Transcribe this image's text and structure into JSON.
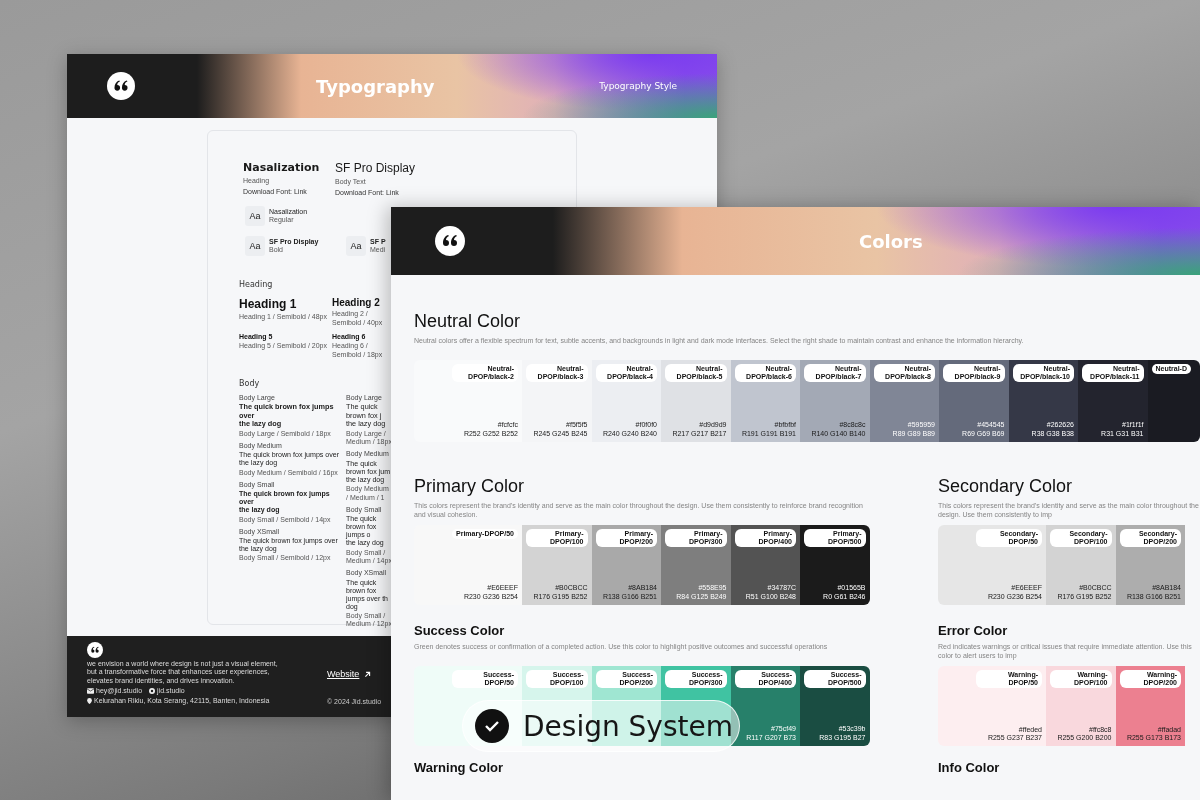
{
  "typography_page": {
    "header": {
      "title": "Typography",
      "subtitle": "Typography Style"
    },
    "fonts": [
      {
        "name": "Nasalization",
        "role": "Heading",
        "download": "Download Font: Link"
      },
      {
        "name": "SF Pro Display",
        "role": "Body Text",
        "download": "Download Font: Link"
      }
    ],
    "samples": [
      [
        {
          "glyph": "Aa",
          "name": "Nasalization",
          "weight": "Regular"
        }
      ],
      [
        {
          "glyph": "Aa",
          "name": "SF Pro Display",
          "weight": "Bold"
        },
        {
          "glyph": "Aa",
          "name": "SF P",
          "weight": "Medi"
        }
      ]
    ],
    "heading_section": {
      "title": "Heading",
      "items": [
        {
          "kind": "h1",
          "label": "Heading 1",
          "spec": "Heading 1 / Semibold / 48px"
        },
        {
          "kind": "h2",
          "label": "Heading 2",
          "spec": "Heading 2 / Semibold / 40px"
        },
        {
          "kind": "h5",
          "label": "Heading 5",
          "spec": "Heading 5 / Semibold / 20px"
        },
        {
          "kind": "h6",
          "label": "Heading 6",
          "spec": "Heading 6 / Semibold / 18px"
        }
      ]
    },
    "body_section": {
      "title": "Body",
      "columns": [
        [
          {
            "kind": "large",
            "label": "Body Large",
            "semibold": true,
            "lines": [
              "The quick brown fox jumps over",
              "the lazy dog"
            ],
            "spec": "Body Large / Semibold / 18px"
          },
          {
            "kind": "medium",
            "label": "Body Medium",
            "semibold": false,
            "lines": [
              "The quick brown fox jumps over",
              "the lazy dog"
            ],
            "spec": "Body Medium / Semibold / 16px"
          },
          {
            "kind": "small",
            "label": "Body Small",
            "semibold": true,
            "lines": [
              "The quick brown fox jumps over",
              "the lazy dog"
            ],
            "spec": "Body Small / Semibold / 14px"
          },
          {
            "kind": "xsmall",
            "label": "Body XSmall",
            "semibold": false,
            "lines": [
              "The quick brown fox jumps over",
              "the lazy dog"
            ],
            "spec": "Body Small / Semibold / 12px"
          }
        ],
        [
          {
            "kind": "large",
            "label": "Body Large",
            "semibold": false,
            "lines": [
              "The quick brown fox j",
              "the lazy dog"
            ],
            "spec": "Body Large / Medium / 18px"
          },
          {
            "kind": "medium",
            "label": "Body Medium",
            "semibold": false,
            "lines": [
              "The quick brown fox jum",
              "the lazy dog"
            ],
            "spec": "Body Medium / Medium / 1"
          },
          {
            "kind": "small",
            "label": "Body Small",
            "semibold": false,
            "lines": [
              "The quick brown fox jumps o",
              "the lazy dog"
            ],
            "spec": "Body Small / Medium / 14px"
          },
          {
            "kind": "xsmall",
            "label": "Body XSmall",
            "semibold": false,
            "lines": [
              "The quick brown fox jumps over th",
              "dog"
            ],
            "spec": "Body Small / Medium / 12px"
          }
        ]
      ]
    },
    "footer": {
      "text": "we envision a world where design is not just a visual element, but a transformative force that enhances user experiences, elevates brand identities, and drives innovation.",
      "contacts": [
        {
          "kind": "mail",
          "text": "hey@jid.studio"
        },
        {
          "kind": "social",
          "text": "jid.studio"
        },
        {
          "kind": "location",
          "text": "Kelurahan Rikiu, Kota Serang, 42115, Banten, Indonesia"
        }
      ],
      "link": "Website",
      "copyright": "© 2024 Jid.studio"
    }
  },
  "colors_page": {
    "header": {
      "title": "Colors"
    },
    "rows": [
      [
        {
          "title": "Neutral Color",
          "description": "Neutral colors offer a flexible spectrum for text, subtle accents, and backgrounds in light and dark mode interfaces. Select the right shade to maintain contrast and enhance the information hierarchy.",
          "swatches": [
            {
              "label": "Neutral-DPOP/black-2",
              "hex": "#fcfcfc",
              "rgb": "R252 G252 B252",
              "color": "#f9fafb"
            },
            {
              "label": "Neutral-DPOP/black-3",
              "hex": "#f5f5f5",
              "rgb": "R245 G245 B245",
              "color": "#f4f5f7"
            },
            {
              "label": "Neutral-DPOP/black-4",
              "hex": "#f0f0f0",
              "rgb": "R240 G240 B240",
              "color": "#eceef2"
            },
            {
              "label": "Neutral-DPOP/black-5",
              "hex": "#d9d9d9",
              "rgb": "R217 G217 B217",
              "color": "#dfe1e5"
            },
            {
              "label": "Neutral-DPOP/black-6",
              "hex": "#bfbfbf",
              "rgb": "R191 G191 B191",
              "color": "#c0c5cf"
            },
            {
              "label": "Neutral-DPOP/black-7",
              "hex": "#8c8c8c",
              "rgb": "R140 G140 B140",
              "color": "#a3a9b5"
            },
            {
              "label": "Neutral-DPOP/black-8",
              "hex": "#595959",
              "rgb": "R89 G89 B89",
              "color": "#808696"
            },
            {
              "label": "Neutral-DPOP/black-9",
              "hex": "#454545",
              "rgb": "R69 G69 B69",
              "color": "#646a7b"
            },
            {
              "label": "Neutral-DPOP/black-10",
              "hex": "#262626",
              "rgb": "R38 G38 B38",
              "color": "#353847"
            },
            {
              "label": "Neutral-DPOP/black-11",
              "hex": "#1f1f1f",
              "rgb": "R31 G31 B31",
              "color": "#23242e"
            },
            {
              "label": "Neutral-D",
              "color": "#1a1b22"
            }
          ]
        }
      ],
      [
        {
          "title": "Primary Color",
          "description": "This colors represent the brand's identity and serve as the main color throughout the design. Use them consistently to reinforce brand recognition and visual cohesion.",
          "swatches": [
            {
              "label": "Primary-DPOP/50",
              "hex": "#E6EEEF",
              "rgb": "R230 G236 B254",
              "color": "#f8f8f8"
            },
            {
              "label": "Primary-DPOP/100",
              "hex": "#B0CBCC",
              "rgb": "R176 G195 B252",
              "color": "#d3d3d3"
            },
            {
              "label": "Primary-DPOP/200",
              "hex": "#8AB184",
              "rgb": "R138 G166 B251",
              "color": "#a9a9a9"
            },
            {
              "label": "Primary-DPOP/300",
              "hex": "#558E95",
              "rgb": "R84 G125 B249",
              "color": "#7e7e7e"
            },
            {
              "label": "Primary-DPOP/400",
              "hex": "#34787C",
              "rgb": "R51 G100 B248",
              "color": "#535353"
            },
            {
              "label": "Primary-DPOP/500",
              "hex": "#01565B",
              "rgb": "R0 G61 B246",
              "color": "#1b1b1b"
            }
          ]
        },
        {
          "title": "Secondary Color",
          "description": "This colors represent the brand's identity and serve as the main color throughout the design. Use them consistently to imp",
          "swatches": [
            {
              "label": "Secondary-DPOP/50",
              "hex": "#E6EEEF",
              "rgb": "R230 G236 B254",
              "color": "#e6e6e6"
            },
            {
              "label": "Secondary-DPOP/100",
              "hex": "#B0CBCC",
              "rgb": "R176 G195 B252",
              "color": "#d3d3d3"
            },
            {
              "label": "Secondary-DPOP/200",
              "hex": "#8AB184",
              "rgb": "R138 G166 B251",
              "color": "#adadad"
            }
          ]
        }
      ],
      [
        {
          "title": "Success Color",
          "description": "Green denotes success or confirmation of a completed action. Use this color to highlight positive outcomes and successful operations",
          "swatches": [
            {
              "label": "Success-DPOP/50",
              "color": "#effcf8"
            },
            {
              "label": "Success-DPOP/100",
              "color": "#d6f5ec"
            },
            {
              "label": "Success-DPOP/200",
              "color": "#9fe6d2"
            },
            {
              "label": "Success-DPOP/300",
              "color": "#40c3a2"
            },
            {
              "label": "Success-DPOP/400",
              "hex": "#75cf49",
              "rgb": "R117 G207 B73",
              "color": "#27806a"
            },
            {
              "label": "Success-DPOP/500",
              "hex": "#53c39b",
              "rgb": "R83 G195 B27",
              "color": "#1a4d42"
            }
          ]
        },
        {
          "title": "Error Color",
          "description": "Red indicates warnings or critical issues that require immediate attention. Use this color to alert users to imp",
          "swatches": [
            {
              "label": "Warning-DPOP/50",
              "hex": "#ffeded",
              "rgb": "R255 G237 B237",
              "color": "#fdeef0"
            },
            {
              "label": "Warning-DPOP/100",
              "hex": "#ffc8c8",
              "rgb": "R255 G200 B200",
              "color": "#f9d8dd"
            },
            {
              "label": "Warning-DPOP/200",
              "hex": "#ffadad",
              "rgb": "R255 G173 B173",
              "color": "#ec8090"
            }
          ]
        }
      ],
      [
        {
          "title": "Warning Color"
        },
        {
          "title": "Info Color"
        }
      ]
    ]
  },
  "badge": {
    "text": "Design System"
  }
}
